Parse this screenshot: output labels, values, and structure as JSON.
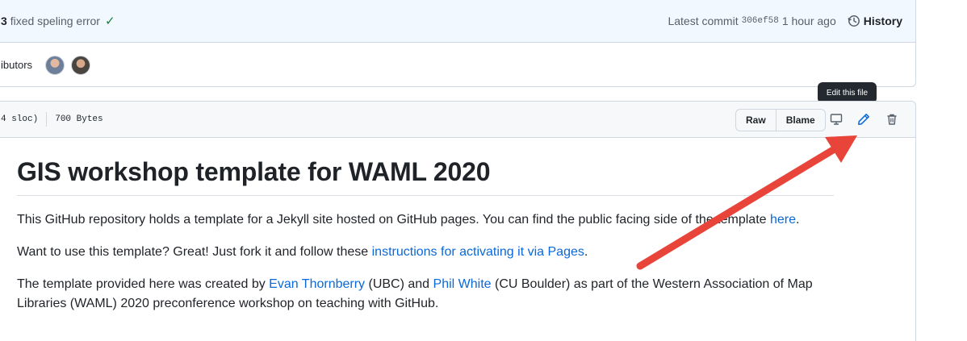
{
  "commit": {
    "message_prefix": "3",
    "message": "fixed speling error",
    "latest_label": "Latest commit",
    "sha": "306ef58",
    "time_ago": "1 hour ago",
    "history_label": "History"
  },
  "contributors": {
    "label": "ibutors"
  },
  "file": {
    "sloc": "4 sloc)",
    "size": "700 Bytes",
    "raw_label": "Raw",
    "blame_label": "Blame",
    "tooltip": "Edit this file"
  },
  "readme": {
    "title": "GIS workshop template for WAML 2020",
    "p1_text": "This GitHub repository holds a template for a Jekyll site hosted on GitHub pages. You can find the public facing side of the template ",
    "p1_link": "here",
    "p1_end": ".",
    "p2_text": "Want to use this template? Great! Just fork it and follow these ",
    "p2_link": "instructions for activating it via Pages",
    "p2_end": ".",
    "p3_a": "The template provided here was created by ",
    "p3_link1": "Evan Thornberry",
    "p3_b": " (UBC) and ",
    "p3_link2": "Phil White",
    "p3_c": " (CU Boulder) as part of the Western Association of Map Libraries (WAML) 2020 preconference workshop on teaching with GitHub."
  },
  "colors": {
    "accent": "#0969da",
    "annotation_arrow": "#e8443a",
    "success": "#1a7f37"
  },
  "icons": [
    "check-icon",
    "history-icon",
    "desktop-icon",
    "pencil-icon",
    "trash-icon"
  ]
}
